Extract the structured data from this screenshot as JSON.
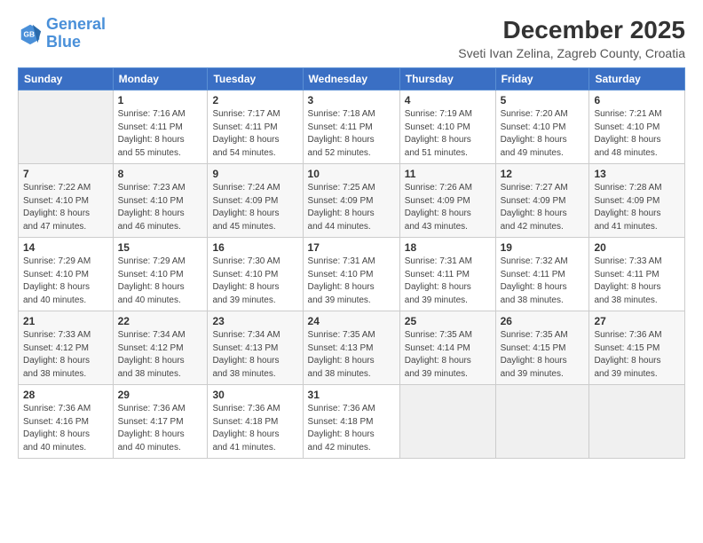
{
  "header": {
    "logo_line1": "General",
    "logo_line2": "Blue",
    "title": "December 2025",
    "subtitle": "Sveti Ivan Zelina, Zagreb County, Croatia"
  },
  "weekdays": [
    "Sunday",
    "Monday",
    "Tuesday",
    "Wednesday",
    "Thursday",
    "Friday",
    "Saturday"
  ],
  "weeks": [
    [
      {
        "day": "",
        "info": ""
      },
      {
        "day": "1",
        "info": "Sunrise: 7:16 AM\nSunset: 4:11 PM\nDaylight: 8 hours\nand 55 minutes."
      },
      {
        "day": "2",
        "info": "Sunrise: 7:17 AM\nSunset: 4:11 PM\nDaylight: 8 hours\nand 54 minutes."
      },
      {
        "day": "3",
        "info": "Sunrise: 7:18 AM\nSunset: 4:11 PM\nDaylight: 8 hours\nand 52 minutes."
      },
      {
        "day": "4",
        "info": "Sunrise: 7:19 AM\nSunset: 4:10 PM\nDaylight: 8 hours\nand 51 minutes."
      },
      {
        "day": "5",
        "info": "Sunrise: 7:20 AM\nSunset: 4:10 PM\nDaylight: 8 hours\nand 49 minutes."
      },
      {
        "day": "6",
        "info": "Sunrise: 7:21 AM\nSunset: 4:10 PM\nDaylight: 8 hours\nand 48 minutes."
      }
    ],
    [
      {
        "day": "7",
        "info": "Sunrise: 7:22 AM\nSunset: 4:10 PM\nDaylight: 8 hours\nand 47 minutes."
      },
      {
        "day": "8",
        "info": "Sunrise: 7:23 AM\nSunset: 4:10 PM\nDaylight: 8 hours\nand 46 minutes."
      },
      {
        "day": "9",
        "info": "Sunrise: 7:24 AM\nSunset: 4:09 PM\nDaylight: 8 hours\nand 45 minutes."
      },
      {
        "day": "10",
        "info": "Sunrise: 7:25 AM\nSunset: 4:09 PM\nDaylight: 8 hours\nand 44 minutes."
      },
      {
        "day": "11",
        "info": "Sunrise: 7:26 AM\nSunset: 4:09 PM\nDaylight: 8 hours\nand 43 minutes."
      },
      {
        "day": "12",
        "info": "Sunrise: 7:27 AM\nSunset: 4:09 PM\nDaylight: 8 hours\nand 42 minutes."
      },
      {
        "day": "13",
        "info": "Sunrise: 7:28 AM\nSunset: 4:09 PM\nDaylight: 8 hours\nand 41 minutes."
      }
    ],
    [
      {
        "day": "14",
        "info": "Sunrise: 7:29 AM\nSunset: 4:10 PM\nDaylight: 8 hours\nand 40 minutes."
      },
      {
        "day": "15",
        "info": "Sunrise: 7:29 AM\nSunset: 4:10 PM\nDaylight: 8 hours\nand 40 minutes."
      },
      {
        "day": "16",
        "info": "Sunrise: 7:30 AM\nSunset: 4:10 PM\nDaylight: 8 hours\nand 39 minutes."
      },
      {
        "day": "17",
        "info": "Sunrise: 7:31 AM\nSunset: 4:10 PM\nDaylight: 8 hours\nand 39 minutes."
      },
      {
        "day": "18",
        "info": "Sunrise: 7:31 AM\nSunset: 4:11 PM\nDaylight: 8 hours\nand 39 minutes."
      },
      {
        "day": "19",
        "info": "Sunrise: 7:32 AM\nSunset: 4:11 PM\nDaylight: 8 hours\nand 38 minutes."
      },
      {
        "day": "20",
        "info": "Sunrise: 7:33 AM\nSunset: 4:11 PM\nDaylight: 8 hours\nand 38 minutes."
      }
    ],
    [
      {
        "day": "21",
        "info": "Sunrise: 7:33 AM\nSunset: 4:12 PM\nDaylight: 8 hours\nand 38 minutes."
      },
      {
        "day": "22",
        "info": "Sunrise: 7:34 AM\nSunset: 4:12 PM\nDaylight: 8 hours\nand 38 minutes."
      },
      {
        "day": "23",
        "info": "Sunrise: 7:34 AM\nSunset: 4:13 PM\nDaylight: 8 hours\nand 38 minutes."
      },
      {
        "day": "24",
        "info": "Sunrise: 7:35 AM\nSunset: 4:13 PM\nDaylight: 8 hours\nand 38 minutes."
      },
      {
        "day": "25",
        "info": "Sunrise: 7:35 AM\nSunset: 4:14 PM\nDaylight: 8 hours\nand 39 minutes."
      },
      {
        "day": "26",
        "info": "Sunrise: 7:35 AM\nSunset: 4:15 PM\nDaylight: 8 hours\nand 39 minutes."
      },
      {
        "day": "27",
        "info": "Sunrise: 7:36 AM\nSunset: 4:15 PM\nDaylight: 8 hours\nand 39 minutes."
      }
    ],
    [
      {
        "day": "28",
        "info": "Sunrise: 7:36 AM\nSunset: 4:16 PM\nDaylight: 8 hours\nand 40 minutes."
      },
      {
        "day": "29",
        "info": "Sunrise: 7:36 AM\nSunset: 4:17 PM\nDaylight: 8 hours\nand 40 minutes."
      },
      {
        "day": "30",
        "info": "Sunrise: 7:36 AM\nSunset: 4:18 PM\nDaylight: 8 hours\nand 41 minutes."
      },
      {
        "day": "31",
        "info": "Sunrise: 7:36 AM\nSunset: 4:18 PM\nDaylight: 8 hours\nand 42 minutes."
      },
      {
        "day": "",
        "info": ""
      },
      {
        "day": "",
        "info": ""
      },
      {
        "day": "",
        "info": ""
      }
    ]
  ]
}
